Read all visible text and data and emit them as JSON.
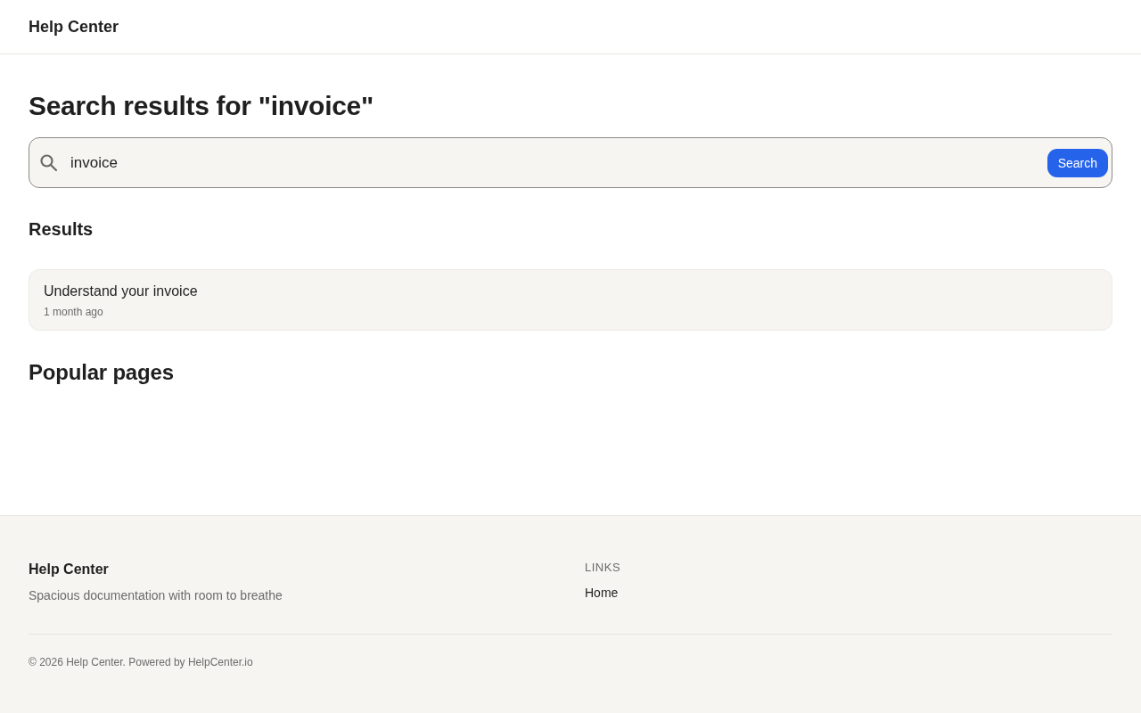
{
  "header": {
    "title": "Help Center"
  },
  "page_title": "Search results for \"invoice\"",
  "search": {
    "value": "invoice",
    "button": "Search"
  },
  "results": {
    "heading": "Results",
    "items": [
      {
        "title": "Understand your invoice",
        "time": "1 month ago"
      }
    ]
  },
  "popular": {
    "heading": "Popular pages"
  },
  "footer": {
    "brand": "Help Center",
    "tagline": "Spacious documentation with room to breathe",
    "links_heading": "LINKS",
    "links": [
      "Home"
    ],
    "copyright": "© 2026 Help Center. Powered by HelpCenter.io"
  }
}
